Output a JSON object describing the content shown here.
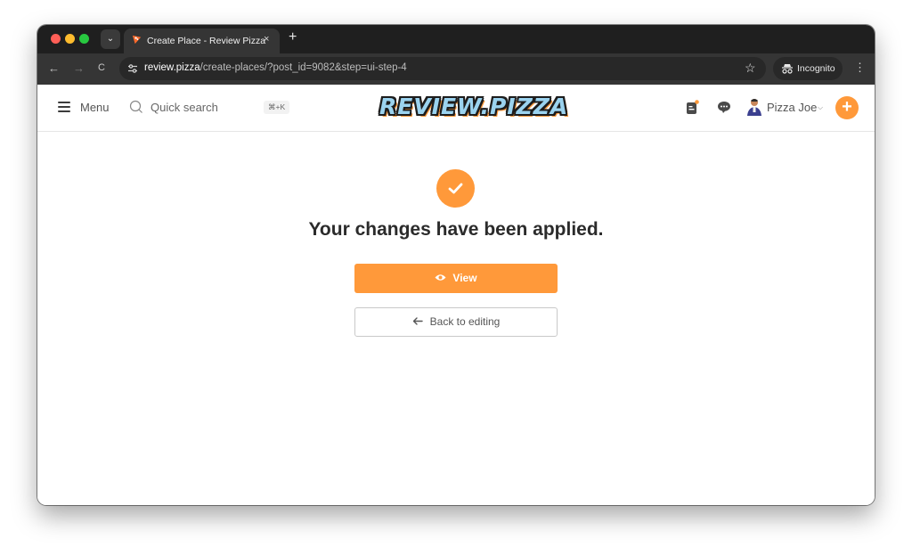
{
  "browser": {
    "tab": {
      "title": "Create Place - Review Pizza",
      "close": "×"
    },
    "new_tab": "+",
    "tab_menu": "⌄",
    "nav": {
      "back": "←",
      "forward": "→",
      "reload": "C"
    },
    "address": {
      "host": "review.pizza",
      "path": "/create-places/?post_id=9082&step=ui-step-4"
    },
    "star": "☆",
    "incognito_label": "Incognito",
    "menu": "⋮"
  },
  "header": {
    "menu_label": "Menu",
    "search_label": "Quick search",
    "search_shortcut": "⌘+K",
    "logo_text": "REVIEW.PIZZA",
    "user_name": "Pizza Joe",
    "user_chevron": "⌵",
    "add_label": "+"
  },
  "content": {
    "message": "Your changes have been applied.",
    "view_label": "View",
    "back_label": "Back to editing"
  },
  "colors": {
    "accent": "#ff993a",
    "tabstrip": "#1f1f1f",
    "toolbar": "#353535"
  }
}
